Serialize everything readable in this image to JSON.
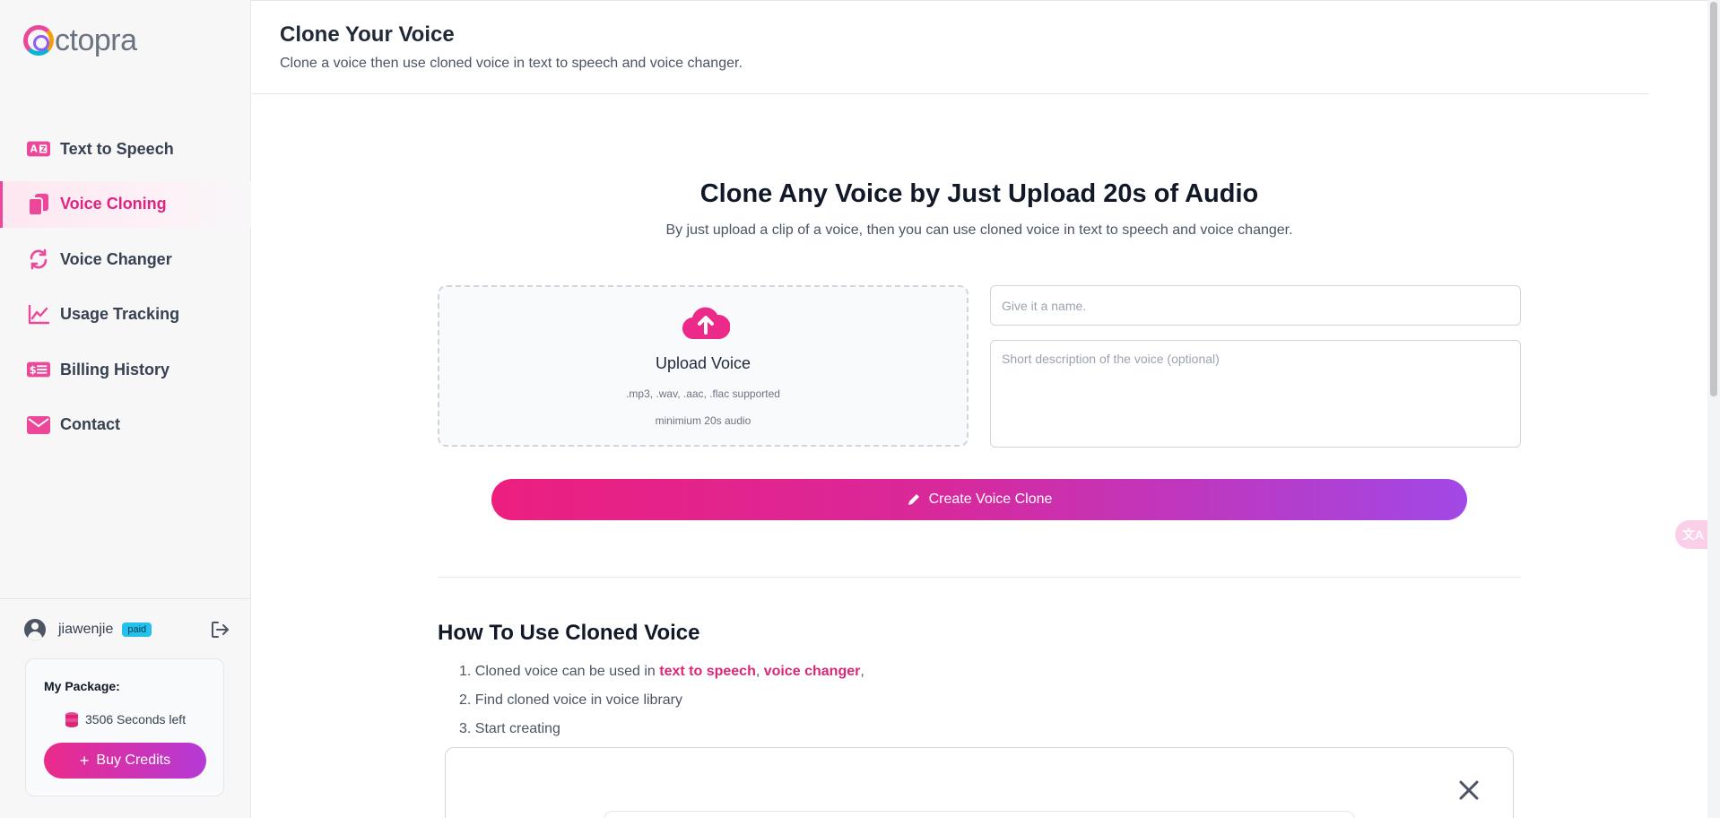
{
  "app": {
    "logo_text": "ctopra"
  },
  "sidebar": {
    "items": [
      {
        "label": "Text to Speech",
        "icon": "text-to-speech-icon",
        "active": false
      },
      {
        "label": "Voice Cloning",
        "icon": "voice-cloning-icon",
        "active": true
      },
      {
        "label": "Voice Changer",
        "icon": "voice-changer-icon",
        "active": false
      },
      {
        "label": "Usage Tracking",
        "icon": "chart-icon",
        "active": false
      },
      {
        "label": "Billing History",
        "icon": "billing-icon",
        "active": false
      },
      {
        "label": "Contact",
        "icon": "mail-icon",
        "active": false
      }
    ],
    "user": {
      "name": "jiawenjie",
      "badge": "paid"
    },
    "package": {
      "title": "My Package:",
      "seconds_left": "3506 Seconds left",
      "buy_label": "Buy Credits",
      "buy_icon": "plus"
    }
  },
  "header": {
    "title": "Clone Your Voice",
    "subtitle": "Clone a voice then use cloned voice in text to speech and voice changer."
  },
  "hero": {
    "title": "Clone Any Voice by Just Upload 20s of Audio",
    "subtitle": "By just upload a clip of a voice, then you can use cloned voice in text to speech and voice changer."
  },
  "upload": {
    "label": "Upload Voice",
    "formats": ".mp3, .wav, .aac, .flac supported",
    "minimum": "minimium 20s audio"
  },
  "form": {
    "name_placeholder": "Give it a name.",
    "name_value": "",
    "description_placeholder": "Short description of the voice (optional)",
    "description_value": "",
    "submit_label": "Create Voice Clone"
  },
  "howto": {
    "title": "How To Use Cloned Voice",
    "step1_prefix": "1. Cloned voice can be used in ",
    "step1_link1": "text to speech",
    "step1_sep": ", ",
    "step1_link2": "voice changer",
    "step1_suffix": ",",
    "step2": "2. Find cloned voice in voice library",
    "step3": "3. Start creating"
  },
  "floating": {
    "translate_label": "文A"
  },
  "colors": {
    "accent": "#ec4899",
    "accent_dark": "#db2777",
    "gradient_end": "#a148e6",
    "badge": "#22c1ee"
  }
}
